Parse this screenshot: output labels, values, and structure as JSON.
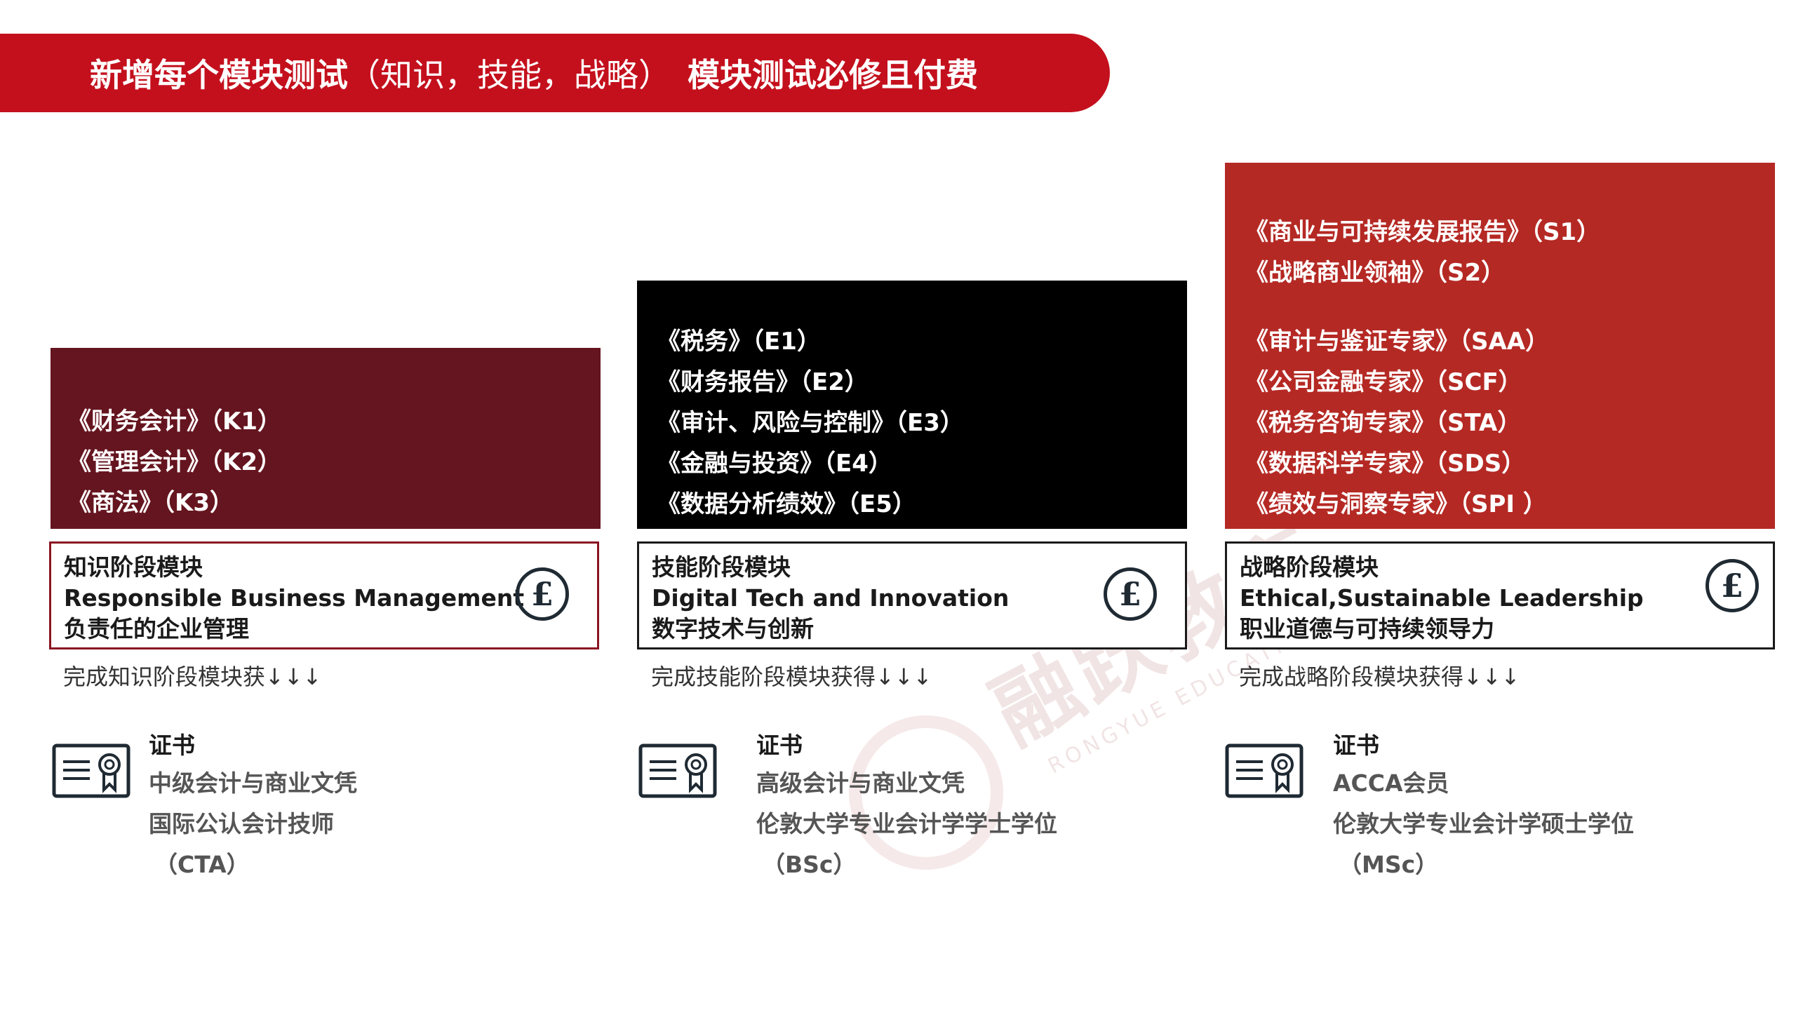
{
  "banner": {
    "part1": "新增每个模块测试",
    "part2": "（知识，技能，战略）",
    "part3": "模块测试必修且付费"
  },
  "watermark": {
    "cn": "融跃教育",
    "en": "RONGYUE EDUCATION"
  },
  "columns": [
    {
      "modules": [
        "《财务会计》（K1）",
        "《管理会计》（K2）",
        "《商法》（K3）"
      ],
      "stage_title": "知识阶段模块",
      "stage_en": "Responsible Business Management",
      "stage_cn": "负责任的企业管理",
      "complete": "完成知识阶段模块获↓↓↓",
      "cert_head": "证书",
      "cert_lines": [
        "中级会计与商业文凭",
        "国际公认会计技师",
        "（CTA）"
      ]
    },
    {
      "modules": [
        "《税务》（E1）",
        "《财务报告》（E2）",
        "《审计、风险与控制》（E3）",
        "《金融与投资》（E4）",
        "《数据分析绩效》（E5）"
      ],
      "stage_title": "技能阶段模块",
      "stage_en": "Digital Tech and Innovation",
      "stage_cn": "数字技术与创新",
      "complete": "完成技能阶段模块获得↓↓↓",
      "cert_head": "证书",
      "cert_lines": [
        "高级会计与商业文凭",
        "伦敦大学专业会计学学士学位",
        "（BSc）"
      ]
    },
    {
      "modules_core": [
        "《商业与可持续发展报告》（S1）",
        "《战略商业领袖》（S2）"
      ],
      "modules": [
        "《审计与鉴证专家》（SAA）",
        "《公司金融专家》（SCF）",
        "《税务咨询专家》（STA）",
        "《数据科学专家》（SDS）",
        "《绩效与洞察专家》（SPI ）"
      ],
      "stage_title": "战略阶段模块",
      "stage_en": "Ethical,Sustainable Leadership",
      "stage_cn": "职业道德与可持续领导力",
      "complete": "完成战略阶段模块获得↓↓↓",
      "cert_head": "证书",
      "cert_lines": [
        "ACCA会员",
        "伦敦大学专业会计学硕士学位",
        "（MSc）"
      ]
    }
  ],
  "pound_symbol": "£",
  "colors": {
    "banner": "#c4101d",
    "knowledge": "#65151f",
    "skills": "#000000",
    "strategic": "#b52924"
  },
  "icons": [
    "pound-icon",
    "certificate-icon"
  ]
}
